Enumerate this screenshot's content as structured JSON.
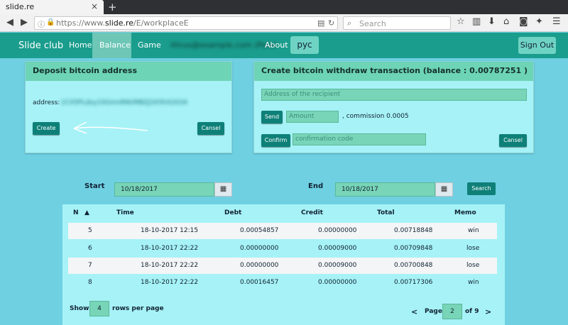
{
  "browser": {
    "tab_title": "slide.re",
    "tab_close": "×",
    "new_tab": "+",
    "url_prefix": "https://www.",
    "url_domain": "slide.re",
    "url_path": "/E/workplaceE",
    "search_placeholder": "Search"
  },
  "site": {
    "brand": "Slide club",
    "menu": {
      "home": "Home",
      "balance": "Balance",
      "game": "Game",
      "email": "illirus@example.com (Polo)",
      "about": "About"
    },
    "lang": "рус",
    "signout": "Sign Out"
  },
  "deposit": {
    "title": "Deposit bitcoin address",
    "address_label": "address:",
    "address_value": "1CX5PLdxy1SGmnRNVMBZJ3X5hX2034",
    "create": "Create",
    "cancel": "Cansel"
  },
  "withdraw": {
    "title": "Create bitcoin withdraw transaction (balance : 0.00787251 )",
    "recipient_placeholder": "Address of the recipient",
    "send": "Send",
    "amount_placeholder": "Amount",
    "commission": ", commission 0.0005",
    "confirm": "Confirm",
    "code_placeholder": "confirmation code",
    "cancel": "Cansel"
  },
  "filters": {
    "start_label": "Start",
    "start_date": "10/18/2017",
    "end_label": "End",
    "end_date": "10/18/2017",
    "search": "Search",
    "calendar_icon": "▦"
  },
  "table": {
    "headers": {
      "n": "N",
      "sort": "▲",
      "time": "Time",
      "debt": "Debt",
      "credit": "Credit",
      "total": "Total",
      "memo": "Memo"
    },
    "rows": [
      {
        "n": "5",
        "time": "18-10-2017 12:15",
        "debt": "0.00054857",
        "credit": "0.00000000",
        "total": "0.00718848",
        "memo": "win"
      },
      {
        "n": "6",
        "time": "18-10-2017 22:22",
        "debt": "0.00000000",
        "credit": "0.00009000",
        "total": "0.00709848",
        "memo": "lose"
      },
      {
        "n": "7",
        "time": "18-10-2017 22:22",
        "debt": "0.00000000",
        "credit": "0.00009000",
        "total": "0.00700848",
        "memo": "lose"
      },
      {
        "n": "8",
        "time": "18-10-2017 22:22",
        "debt": "0.00016457",
        "credit": "0.00000000",
        "total": "0.00717306",
        "memo": "win"
      }
    ]
  },
  "pager": {
    "show": "Show",
    "per_page": "4",
    "rows_per_page": "rows per page",
    "prev": "<",
    "page": "Page",
    "current": "2",
    "of": "of 9",
    "next": ">"
  }
}
